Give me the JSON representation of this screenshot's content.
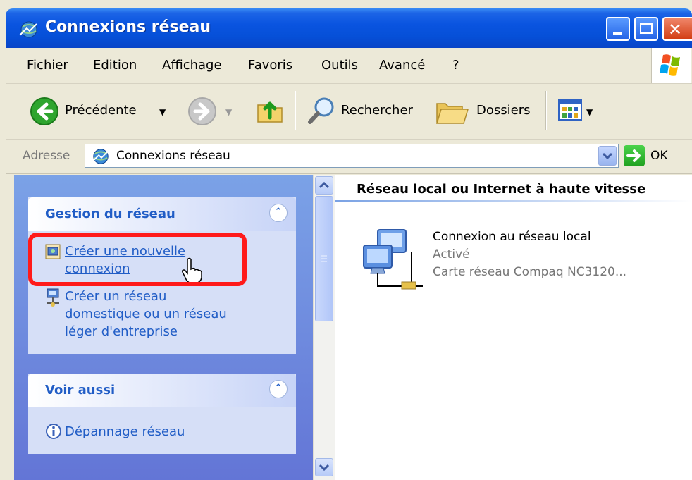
{
  "window": {
    "title": "Connexions réseau"
  },
  "menu": [
    "Fichier",
    "Edition",
    "Affichage",
    "Favoris",
    "Outils",
    "Avancé",
    "?"
  ],
  "toolbar": {
    "back_label": "Précédente",
    "search_label": "Rechercher",
    "folders_label": "Dossiers"
  },
  "address": {
    "label": "Adresse",
    "value": "Connexions réseau",
    "go_label": "OK"
  },
  "tasks_panel": {
    "title": "Gestion du réseau",
    "items": [
      {
        "line1": "Créer une nouvelle",
        "line2": "connexion"
      },
      {
        "line1": "Créer un réseau",
        "line2": "domestique ou un réseau",
        "line3": "léger d'entreprise"
      }
    ]
  },
  "see_also_panel": {
    "title": "Voir aussi",
    "items": [
      "Dépannage réseau"
    ]
  },
  "content": {
    "group_header": "Réseau local ou Internet à haute vitesse",
    "connection": {
      "name": "Connexion au réseau local",
      "status": "Activé",
      "device": "Carte réseau Compaq NC3120..."
    }
  },
  "colors": {
    "titlebar": "#0a54e0",
    "link": "#215dc6",
    "highlight": "#ff1a1a",
    "leftpane": "#6f8de0"
  }
}
